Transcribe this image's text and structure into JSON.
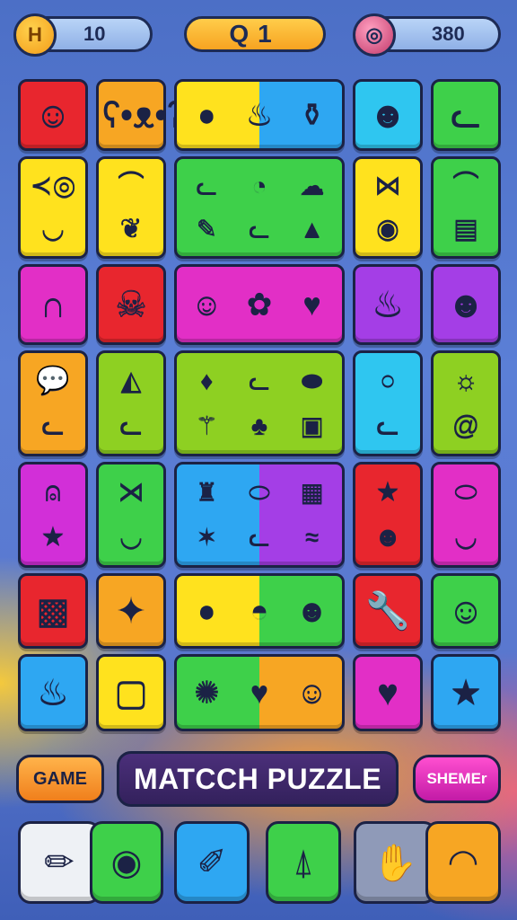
{
  "hud": {
    "coins_icon": "coin-icon",
    "coins_badge": "H",
    "coins": "10",
    "level_prefix": "Q",
    "level": "1",
    "score_icon": "donut-icon",
    "score": "380"
  },
  "board": {
    "rows": [
      [
        {
          "color": "#e8262e",
          "icons": [
            {
              "name": "smiley-face-icon",
              "glyph": "☺"
            }
          ]
        },
        {
          "color": "#f7a623",
          "icons": [
            {
              "name": "bear-face-icon",
              "glyph": "ʕ•ᴥ•ʔ"
            }
          ]
        },
        {
          "color": "linear-gradient(90deg,#ffe21e 0 50%,#2ea7f2 50% 100%)",
          "icons": [
            {
              "name": "green-blob-icon",
              "glyph": "●"
            },
            {
              "name": "flame-drop-icon",
              "glyph": "♨"
            },
            {
              "name": "bottle-icon",
              "glyph": "⚱"
            }
          ]
        },
        {
          "color": "#2fc6f0",
          "icons": [
            {
              "name": "green-block-face-icon",
              "glyph": "☻"
            }
          ]
        },
        {
          "color": "#3ed04a",
          "icons": [
            {
              "name": "cat-face-icon",
              "glyph": "ᓚ"
            }
          ]
        }
      ],
      [
        {
          "color": "#ffe21e",
          "icons": [
            {
              "name": "fish-icon",
              "glyph": "≺◎"
            },
            {
              "name": "bowl-icon",
              "glyph": "◡"
            }
          ]
        },
        {
          "color": "#ffe21e",
          "icons": [
            {
              "name": "rainbow-icon",
              "glyph": "⌒"
            },
            {
              "name": "leaf-icon",
              "glyph": "❦"
            }
          ]
        },
        {
          "color": "#3ed04a",
          "icons": [
            {
              "name": "red-cat-icon",
              "glyph": "ᓚ"
            },
            {
              "name": "chick-icon",
              "glyph": "◔"
            },
            {
              "name": "slime-icon",
              "glyph": "☁"
            },
            {
              "name": "pencil-icon",
              "glyph": "✎"
            },
            {
              "name": "fox-face-icon",
              "glyph": "ᓚ"
            },
            {
              "name": "poop-icon",
              "glyph": "▲"
            }
          ]
        },
        {
          "color": "#ffe21e",
          "icons": [
            {
              "name": "bow-icon",
              "glyph": "⋈"
            },
            {
              "name": "shell-icon",
              "glyph": "◉"
            }
          ]
        },
        {
          "color": "#3ed04a",
          "icons": [
            {
              "name": "rainbow-icon",
              "glyph": "⌒"
            },
            {
              "name": "cake-slice-icon",
              "glyph": "▤"
            }
          ]
        }
      ],
      [
        {
          "color": "#e22fc6",
          "icons": [
            {
              "name": "striped-arch-icon",
              "glyph": "∩"
            }
          ]
        },
        {
          "color": "#e8262e",
          "icons": [
            {
              "name": "skull-icon",
              "glyph": "☠"
            }
          ]
        },
        {
          "color": "#e22fc6",
          "icons": [
            {
              "name": "blue-alien-face-icon",
              "glyph": "☺"
            },
            {
              "name": "shield-rose-icon",
              "glyph": "✿"
            },
            {
              "name": "heart-icon",
              "glyph": "♥"
            }
          ]
        },
        {
          "color": "#a43ee6",
          "icons": [
            {
              "name": "flame-icon",
              "glyph": "♨"
            }
          ]
        },
        {
          "color": "#a43ee6",
          "icons": [
            {
              "name": "green-monster-icon",
              "glyph": "☻"
            }
          ]
        }
      ],
      [
        {
          "color": "#f7a623",
          "icons": [
            {
              "name": "speech-bubble-icon",
              "glyph": "💬"
            },
            {
              "name": "squirrel-face-icon",
              "glyph": "ᓚ"
            }
          ]
        },
        {
          "color": "#8ed022",
          "icons": [
            {
              "name": "pie-icon",
              "glyph": "◭"
            },
            {
              "name": "cat-face-icon",
              "glyph": "ᓚ"
            }
          ]
        },
        {
          "color": "#8ed022",
          "icons": [
            {
              "name": "strawberry-icon",
              "glyph": "♦"
            },
            {
              "name": "fox-face-icon",
              "glyph": "ᓚ"
            },
            {
              "name": "meat-icon",
              "glyph": "⬬"
            },
            {
              "name": "broom-icon",
              "glyph": "⚚"
            },
            {
              "name": "palm-tree-icon",
              "glyph": "♣"
            },
            {
              "name": "jar-face-icon",
              "glyph": "▣"
            }
          ]
        },
        {
          "color": "#2fc6f0",
          "icons": [
            {
              "name": "bubble-icon",
              "glyph": "○"
            },
            {
              "name": "pig-face-icon",
              "glyph": "ᓚ"
            }
          ]
        },
        {
          "color": "#8ed022",
          "icons": [
            {
              "name": "sun-face-icon",
              "glyph": "☼"
            },
            {
              "name": "snail-icon",
              "glyph": "@"
            }
          ]
        }
      ],
      [
        {
          "color": "#d22fd8",
          "icons": [
            {
              "name": "bell-icon",
              "glyph": "⍝"
            },
            {
              "name": "star-icon",
              "glyph": "★"
            }
          ]
        },
        {
          "color": "#3ed04a",
          "icons": [
            {
              "name": "fish-icon",
              "glyph": "⋊"
            },
            {
              "name": "bowl-icon",
              "glyph": "◡"
            }
          ]
        },
        {
          "color": "linear-gradient(90deg,#2ea7f2 0 50%,#a43ee6 50% 100%)",
          "icons": [
            {
              "name": "bag-icon",
              "glyph": "♜"
            },
            {
              "name": "cookie-icon",
              "glyph": "⬭"
            },
            {
              "name": "box-icon",
              "glyph": "▦"
            },
            {
              "name": "starfish-icon",
              "glyph": "✶"
            },
            {
              "name": "cat-face-icon",
              "glyph": "ᓚ"
            },
            {
              "name": "puddle-icon",
              "glyph": "≈"
            }
          ]
        },
        {
          "color": "#e8262e",
          "icons": [
            {
              "name": "star-icon",
              "glyph": "★"
            },
            {
              "name": "pikachu-face-icon",
              "glyph": "☻"
            }
          ]
        },
        {
          "color": "#e22fc6",
          "icons": [
            {
              "name": "cloud-pillow-icon",
              "glyph": "⬭"
            },
            {
              "name": "banana-icon",
              "glyph": "◡"
            }
          ]
        }
      ],
      [
        {
          "color": "#e8262e",
          "icons": [
            {
              "name": "bread-loaf-icon",
              "glyph": "▩"
            }
          ]
        },
        {
          "color": "#f7a623",
          "icons": [
            {
              "name": "star-card-icon",
              "glyph": "✦"
            }
          ]
        },
        {
          "color": "linear-gradient(90deg,#ffe21e 0 50%,#3ed04a 50% 100%)",
          "icons": [
            {
              "name": "dark-blob-face-icon",
              "glyph": "●"
            },
            {
              "name": "pokeball-icon",
              "glyph": "◓"
            },
            {
              "name": "green-robot-icon",
              "glyph": "☻"
            }
          ]
        },
        {
          "color": "#e8262e",
          "icons": [
            {
              "name": "wrench-icon",
              "glyph": "🔧"
            }
          ]
        },
        {
          "color": "#3ed04a",
          "icons": [
            {
              "name": "lion-face-icon",
              "glyph": "☺"
            }
          ]
        }
      ],
      [
        {
          "color": "#2ea7f2",
          "icons": [
            {
              "name": "cupcake-icon",
              "glyph": "♨"
            }
          ]
        },
        {
          "color": "#ffe21e",
          "icons": [
            {
              "name": "bread-face-icon",
              "glyph": "▢"
            }
          ]
        },
        {
          "color": "linear-gradient(90deg,#3ed04a 0 50%,#f7a623 50% 100%)",
          "icons": [
            {
              "name": "pink-fuzzball-icon",
              "glyph": "✺"
            },
            {
              "name": "orange-heart-icon",
              "glyph": "♥"
            },
            {
              "name": "blue-smiley-icon",
              "glyph": "☺"
            }
          ]
        },
        {
          "color": "#e22fc6",
          "icons": [
            {
              "name": "heart-icon",
              "glyph": "♥"
            }
          ]
        },
        {
          "color": "#2ea7f2",
          "icons": [
            {
              "name": "blue-star-icon",
              "glyph": "★"
            }
          ]
        }
      ]
    ]
  },
  "banner": {
    "game_label": "GAME",
    "title": "MATCCH PUZZLE",
    "shemer_label": "SHEMEr"
  },
  "dock": {
    "slots": [
      {
        "name": "pencil-icon",
        "glyph": "✏",
        "color": "#eef1f5"
      },
      {
        "name": "robot-face-icon",
        "glyph": "◉",
        "color": "#3ed04a"
      },
      {
        "name": "paint-brush-icon",
        "glyph": "✐",
        "color": "#2ea7f2"
      },
      {
        "name": "bell-jar-icon",
        "glyph": "⍋",
        "color": "#3ed04a"
      },
      {
        "name": "hand-puppet-icon",
        "glyph": "✋",
        "color": "#8f9ab8"
      },
      {
        "name": "rss-feed-icon",
        "glyph": "◠",
        "color": "#f7a623"
      }
    ]
  }
}
